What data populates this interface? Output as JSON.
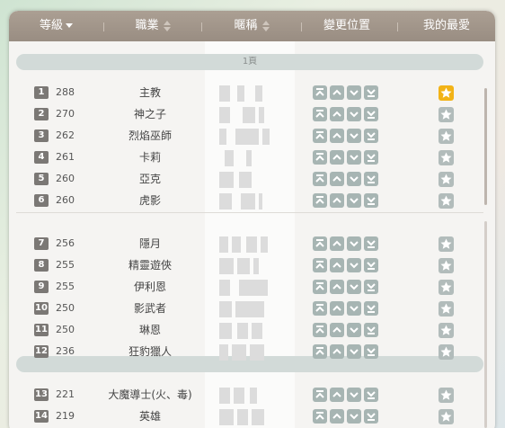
{
  "header": {
    "level": "等級",
    "job": "職業",
    "nickname": "暱稱",
    "reorder": "變更位置",
    "favorite": "我的最愛"
  },
  "page_labels": [
    "1頁",
    ""
  ],
  "rows": [
    {
      "rank": "1",
      "level": "288",
      "job": "主教",
      "favorite": true
    },
    {
      "rank": "2",
      "level": "270",
      "job": "神之子",
      "favorite": false
    },
    {
      "rank": "3",
      "level": "262",
      "job": "烈焰巫師",
      "favorite": false
    },
    {
      "rank": "4",
      "level": "261",
      "job": "卡莉",
      "favorite": false
    },
    {
      "rank": "5",
      "level": "260",
      "job": "亞克",
      "favorite": false
    },
    {
      "rank": "6",
      "level": "260",
      "job": "虎影",
      "favorite": false
    },
    {
      "rank": "7",
      "level": "256",
      "job": "隱月",
      "favorite": false
    },
    {
      "rank": "8",
      "level": "255",
      "job": "精靈遊俠",
      "favorite": false
    },
    {
      "rank": "9",
      "level": "255",
      "job": "伊利恩",
      "favorite": false
    },
    {
      "rank": "10",
      "level": "250",
      "job": "影武者",
      "favorite": false
    },
    {
      "rank": "11",
      "level": "250",
      "job": "琳恩",
      "favorite": false
    },
    {
      "rank": "12",
      "level": "236",
      "job": "狂豹獵人",
      "favorite": false
    },
    {
      "rank": "13",
      "level": "221",
      "job": "大魔導士(火、毒)",
      "favorite": false
    },
    {
      "rank": "14",
      "level": "219",
      "job": "英雄",
      "favorite": false
    }
  ],
  "icons": {
    "move_top": "move-top-icon",
    "move_up": "move-up-icon",
    "move_down": "move-down-icon",
    "move_bottom": "move-bottom-icon",
    "favorite": "star-icon"
  },
  "colors": {
    "header_bg": "#a69a8e",
    "favorite_on": "#f2b317",
    "favorite_off": "#b2bcbb",
    "reorder_button": "#a7b5b3",
    "rank_badge": "#7b7875"
  }
}
